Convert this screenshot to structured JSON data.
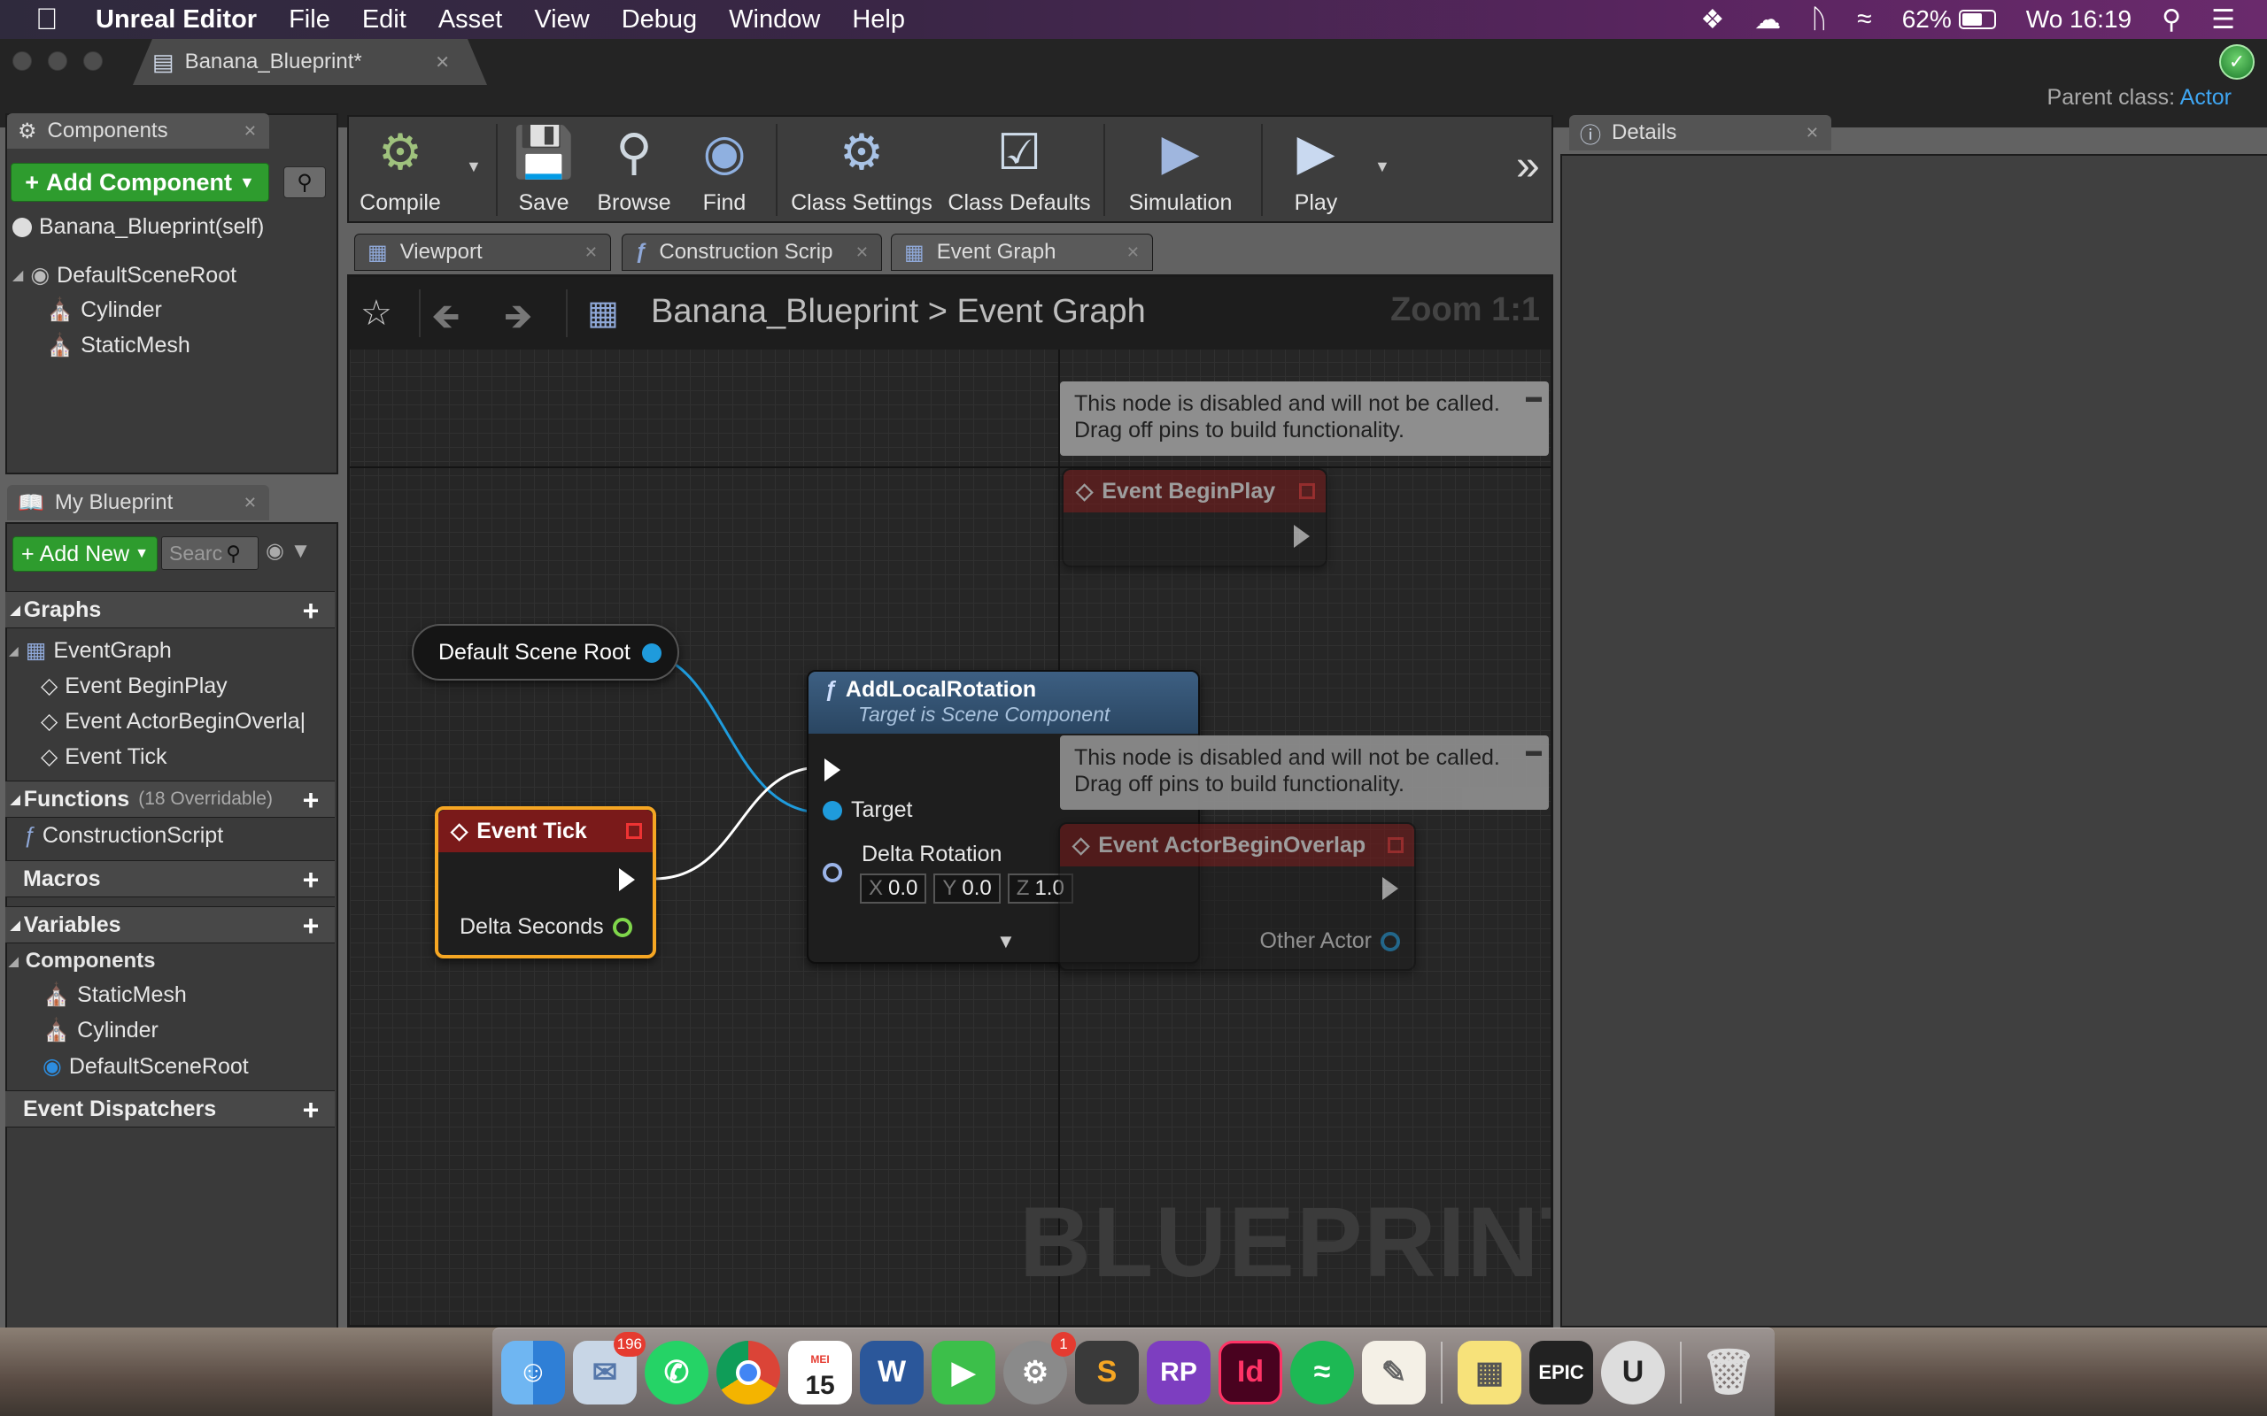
{
  "menubar": {
    "app_name": "Unreal Editor",
    "menus": [
      "File",
      "Edit",
      "Asset",
      "View",
      "Debug",
      "Window",
      "Help"
    ],
    "battery": "62%",
    "clock": "Wo 16:19"
  },
  "window": {
    "tab_title": "Banana_Blueprint*",
    "parent_class_label": "Parent class:",
    "parent_class_value": "Actor"
  },
  "components_panel": {
    "tab": "Components",
    "add_button": "Add Component",
    "tree": [
      "Banana_Blueprint(self)",
      "DefaultSceneRoot",
      "Cylinder",
      "StaticMesh"
    ]
  },
  "my_blueprint": {
    "tab": "My Blueprint",
    "add_new": "Add New",
    "search_placeholder": "Searc",
    "graphs_header": "Graphs",
    "graphs": [
      "EventGraph",
      "Event BeginPlay",
      "Event ActorBeginOverla|",
      "Event Tick"
    ],
    "functions_header": "Functions",
    "functions_count": "(18 Overridable)",
    "functions": [
      "ConstructionScript"
    ],
    "macros_header": "Macros",
    "variables_header": "Variables",
    "components_header": "Components",
    "variables": [
      "StaticMesh",
      "Cylinder",
      "DefaultSceneRoot"
    ],
    "dispatchers_header": "Event Dispatchers"
  },
  "toolbar": {
    "compile": "Compile",
    "save": "Save",
    "browse": "Browse",
    "find": "Find",
    "class_settings": "Class Settings",
    "class_defaults": "Class Defaults",
    "simulation": "Simulation",
    "play": "Play"
  },
  "editor_tabs": [
    "Viewport",
    "Construction Scrip",
    "Event Graph"
  ],
  "graph": {
    "breadcrumb_root": "Banana_Blueprint",
    "breadcrumb_sep": ">",
    "breadcrumb_leaf": "Event Graph",
    "zoom": "Zoom 1:1",
    "watermark": "BLUEPRINT",
    "disabled_comment_line1": "This node is disabled and will not be called.",
    "disabled_comment_line2": "Drag off pins to build functionality.",
    "nodes": {
      "begin_play": "Event BeginPlay",
      "begin_overlap": "Event ActorBeginOverlap",
      "other_actor": "Other Actor",
      "scene_root": "Default Scene Root",
      "event_tick": "Event Tick",
      "delta_seconds": "Delta Seconds",
      "add_rotation_title": "AddLocalRotation",
      "add_rotation_subtitle": "Target is Scene Component",
      "target": "Target",
      "delta_rotation": "Delta Rotation",
      "x_label": "X",
      "x_value": "0.0",
      "y_label": "Y",
      "y_value": "0.0",
      "z_label": "Z",
      "z_value": "1.0"
    }
  },
  "details_panel": {
    "tab": "Details"
  },
  "dock": {
    "mail_badge": "196",
    "prefs_badge": "1",
    "calendar_month": "MEI",
    "calendar_day": "15"
  },
  "colors": {
    "exec_node_red": "#7a1a1a",
    "function_node_blue": "#33506e",
    "object_pin": "#1f9bdc",
    "float_pin": "#7fd64b",
    "selected_outline": "#f5a623",
    "add_button_green": "#2e9c2e"
  }
}
